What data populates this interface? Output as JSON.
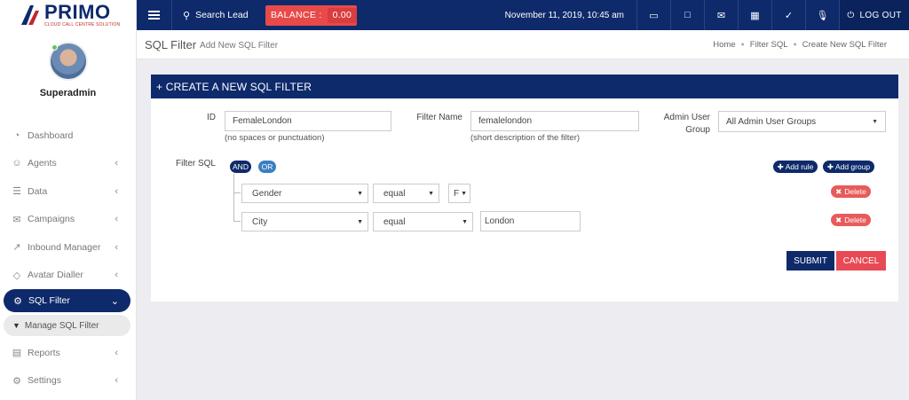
{
  "brand": {
    "name": "PRIMO",
    "tagline": "CLOUD CALL CENTRE SOLUTION"
  },
  "user": {
    "name": "Superadmin"
  },
  "sidebar": {
    "items": [
      {
        "label": "Dashboard",
        "icon": "dashboard-icon"
      },
      {
        "label": "Agents",
        "icon": "agents-icon"
      },
      {
        "label": "Data",
        "icon": "data-icon"
      },
      {
        "label": "Campaigns",
        "icon": "campaigns-icon"
      },
      {
        "label": "Inbound Manager",
        "icon": "inbound-icon"
      },
      {
        "label": "Avatar Dialler",
        "icon": "tag-icon"
      },
      {
        "label": "SQL Filter",
        "icon": "gear-icon"
      },
      {
        "label": "Reports",
        "icon": "reports-icon"
      },
      {
        "label": "Settings",
        "icon": "settings-icon"
      }
    ],
    "sub_item": "Manage SQL Filter"
  },
  "topbar": {
    "search_label": "Search Lead",
    "balance_label": "BALANCE :",
    "balance_value": "0.00",
    "datetime": "November 11, 2019, 10:45 am",
    "logout_label": "LOG OUT"
  },
  "page": {
    "title": "SQL Filter",
    "subtitle": "Add New SQL Filter",
    "breadcrumbs": [
      "Home",
      "Filter SQL",
      "Create New SQL Filter"
    ]
  },
  "form": {
    "header": "+ CREATE A NEW SQL FILTER",
    "id_label": "ID",
    "id_value": "FemaleLondon",
    "id_help": "(no spaces or punctuation)",
    "name_label": "Filter Name",
    "name_value": "femalelondon",
    "name_help": "(short description of the filter)",
    "group_label_1": "Admin User",
    "group_label_2": "Group",
    "group_value": "All Admin User Groups",
    "sql_label": "Filter SQL",
    "and_label": "AND",
    "or_label": "OR",
    "add_rule": "Add rule",
    "add_group": "Add group",
    "rules": [
      {
        "field": "Gender",
        "operator": "equal",
        "value": "F",
        "delete": "Delete"
      },
      {
        "field": "City",
        "operator": "equal",
        "value": "London",
        "delete": "Delete"
      }
    ],
    "submit": "SUBMIT",
    "cancel": "CANCEL"
  },
  "colors": {
    "primary": "#0e2a6b",
    "danger": "#e84a49",
    "or_button": "#3b7fc4"
  }
}
